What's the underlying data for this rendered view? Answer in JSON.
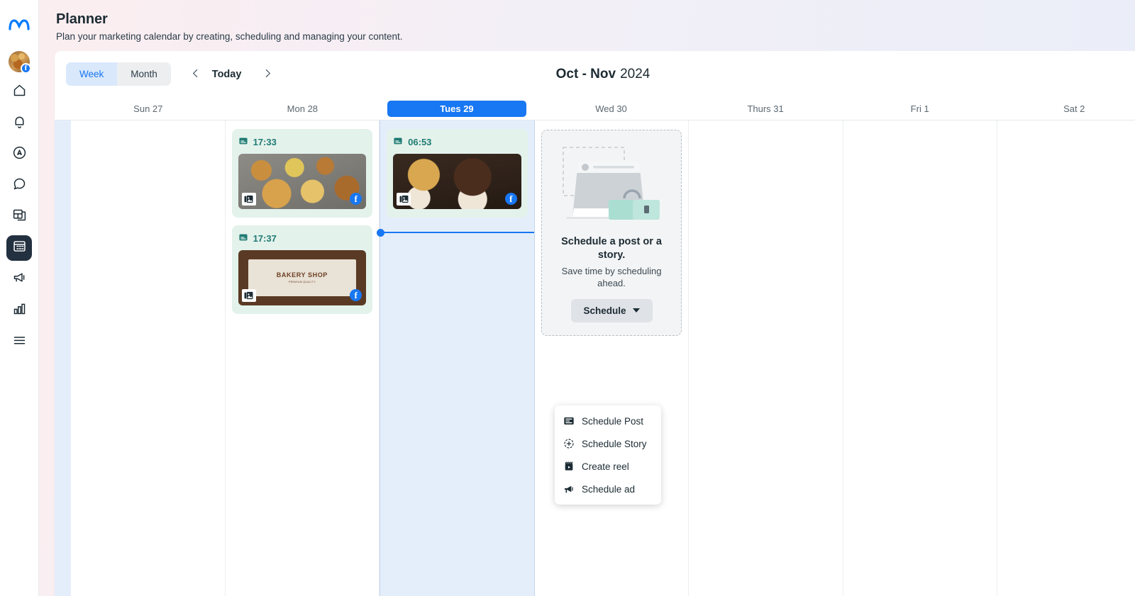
{
  "rail": {
    "logo_icon": "meta-logo-icon",
    "avatar": {
      "name": "account-avatar",
      "badge": "f"
    },
    "items": [
      {
        "name": "home-icon",
        "label": "Home",
        "active": false
      },
      {
        "name": "notifications-bell-icon",
        "label": "Notifications",
        "active": false
      },
      {
        "name": "boost-circle-icon",
        "label": "Boost",
        "active": false
      },
      {
        "name": "messages-chat-icon",
        "label": "Messages",
        "active": false
      },
      {
        "name": "posts-stack-icon",
        "label": "Posts",
        "active": false
      },
      {
        "name": "planner-calendar-icon",
        "label": "Planner",
        "active": true
      },
      {
        "name": "ads-megaphone-icon",
        "label": "Ads",
        "active": false
      },
      {
        "name": "insights-bars-icon",
        "label": "Insights",
        "active": false
      },
      {
        "name": "more-menu-icon",
        "label": "More",
        "active": false
      }
    ]
  },
  "header": {
    "title": "Planner",
    "subtitle": "Plan your marketing calendar by creating, scheduling and managing your content."
  },
  "toolbar": {
    "week_label": "Week",
    "month_label": "Month",
    "today_label": "Today",
    "prev_icon": "chevron-left-icon",
    "next_icon": "chevron-right-icon",
    "range_main": "Oct - Nov",
    "range_year": "2024"
  },
  "calendar": {
    "days": [
      {
        "label": "Sun 27",
        "today": false
      },
      {
        "label": "Mon 28",
        "today": false
      },
      {
        "label": "Tues 29",
        "today": true
      },
      {
        "label": "Wed 30",
        "today": false
      },
      {
        "label": "Thurs 31",
        "today": false
      },
      {
        "label": "Fri 1",
        "today": false
      },
      {
        "label": "Sat 2",
        "today": false
      }
    ],
    "posts": {
      "mon_first": {
        "time": "17:33",
        "type_icon": "post-icon",
        "media_icon": "carousel-icon",
        "platform_icon": "facebook-icon"
      },
      "mon_second": {
        "time": "17:37",
        "type_icon": "post-icon",
        "media_icon": "carousel-icon",
        "platform_icon": "facebook-icon",
        "banner_line1": "BAKERY\nSHOP",
        "banner_line2": "PREMIUM QUALITY"
      },
      "tue_first": {
        "time": "06:53",
        "type_icon": "post-icon",
        "media_icon": "carousel-icon",
        "platform_icon": "facebook-icon"
      }
    }
  },
  "empty_state": {
    "title": "Schedule a post or a story.",
    "body": "Save time by scheduling ahead.",
    "button_label": "Schedule",
    "illustration": "laptop-and-toolbox-illustration"
  },
  "schedule_menu": {
    "items": [
      {
        "label": "Schedule Post",
        "icon": "post-icon"
      },
      {
        "label": "Schedule Story",
        "icon": "story-plus-icon"
      },
      {
        "label": "Create reel",
        "icon": "reel-clapper-icon"
      },
      {
        "label": "Schedule ad",
        "icon": "megaphone-icon"
      }
    ]
  },
  "colors": {
    "accent_blue": "#1877f2",
    "post_green": "#e4f2ec",
    "post_teal_text": "#1e7b72",
    "today_col": "#e4eefb"
  }
}
